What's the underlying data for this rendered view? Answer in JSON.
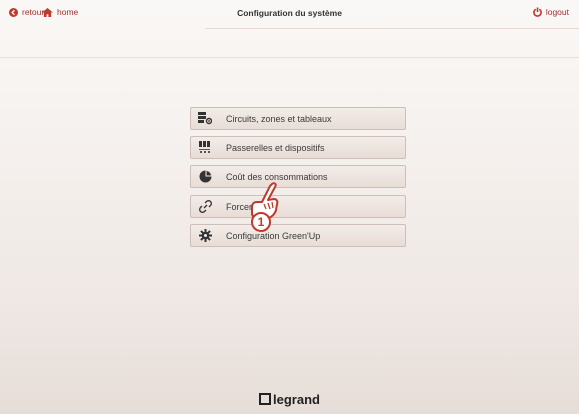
{
  "topbar": {
    "back_label": "retour",
    "home_label": "home",
    "title": "Configuration du système",
    "logout_label": "logout"
  },
  "menu": [
    {
      "label": "Circuits, zones et tableaux",
      "icon": "circuits-icon"
    },
    {
      "label": "Passerelles et dispositifs",
      "icon": "devices-icon"
    },
    {
      "label": "Coût des consommations",
      "icon": "pie-chart-icon"
    },
    {
      "label": "Forcer/Relier",
      "icon": "link-icon"
    },
    {
      "label": "Configuration Green'Up",
      "icon": "gear-icon"
    }
  ],
  "callout": {
    "number": "1"
  },
  "footer": {
    "brand": "legrand"
  },
  "colors": {
    "accent": "#a0322d",
    "text": "#3a3a3a"
  }
}
